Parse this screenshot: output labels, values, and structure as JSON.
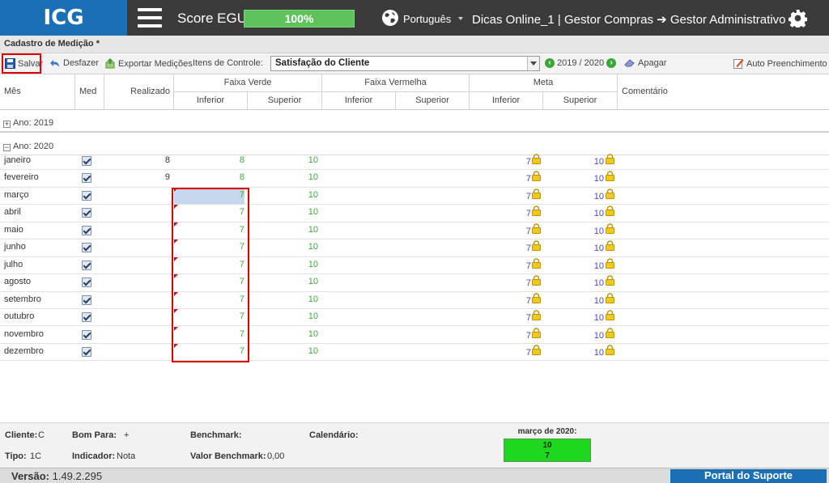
{
  "topbar": {
    "logo": "ICG",
    "score_label": "Score EGU:",
    "score_value": "100%",
    "language": "Português",
    "user_path": "Dicas Online_1  |  Gestor Compras ➔ Gestor Administrativo"
  },
  "panel": {
    "title": "Cadastro de Medição *"
  },
  "toolbar": {
    "save": "Salvar",
    "undo": "Desfazer",
    "export": "Exportar Medições",
    "items_label": "Itens de Controle:",
    "item_selected": "Satisfação do Cliente",
    "period": "2019 / 2020",
    "delete": "Apagar",
    "auto_fill": "Auto Preenchimento"
  },
  "grid": {
    "headers": {
      "mes": "Mês",
      "med": "Med",
      "realizado": "Realizado",
      "faixa_verde": "Faixa Verde",
      "faixa_vermelha": "Faixa Vermelha",
      "meta": "Meta",
      "inferior": "Inferior",
      "superior": "Superior",
      "comentario": "Comentário"
    },
    "year_2019": "Ano: 2019",
    "year_2020": "Ano: 2020",
    "rows": [
      {
        "mes": "janeiro",
        "realizado": "8",
        "verde_inf": "8",
        "verde_sup": "10",
        "meta_inf": "7",
        "meta_sup": "10"
      },
      {
        "mes": "fevereiro",
        "realizado": "9",
        "verde_inf": "8",
        "verde_sup": "10",
        "meta_inf": "7",
        "meta_sup": "10"
      },
      {
        "mes": "março",
        "realizado": "",
        "verde_inf": "7",
        "verde_sup": "10",
        "meta_inf": "7",
        "meta_sup": "10"
      },
      {
        "mes": "abril",
        "realizado": "",
        "verde_inf": "7",
        "verde_sup": "10",
        "meta_inf": "7",
        "meta_sup": "10"
      },
      {
        "mes": "maio",
        "realizado": "",
        "verde_inf": "7",
        "verde_sup": "10",
        "meta_inf": "7",
        "meta_sup": "10"
      },
      {
        "mes": "junho",
        "realizado": "",
        "verde_inf": "7",
        "verde_sup": "10",
        "meta_inf": "7",
        "meta_sup": "10"
      },
      {
        "mes": "julho",
        "realizado": "",
        "verde_inf": "7",
        "verde_sup": "10",
        "meta_inf": "7",
        "meta_sup": "10"
      },
      {
        "mes": "agosto",
        "realizado": "",
        "verde_inf": "7",
        "verde_sup": "10",
        "meta_inf": "7",
        "meta_sup": "10"
      },
      {
        "mes": "setembro",
        "realizado": "",
        "verde_inf": "7",
        "verde_sup": "10",
        "meta_inf": "7",
        "meta_sup": "10"
      },
      {
        "mes": "outubro",
        "realizado": "",
        "verde_inf": "7",
        "verde_sup": "10",
        "meta_inf": "7",
        "meta_sup": "10"
      },
      {
        "mes": "novembro",
        "realizado": "",
        "verde_inf": "7",
        "verde_sup": "10",
        "meta_inf": "7",
        "meta_sup": "10"
      },
      {
        "mes": "dezembro",
        "realizado": "",
        "verde_inf": "7",
        "verde_sup": "10",
        "meta_inf": "7",
        "meta_sup": "10"
      }
    ]
  },
  "footer": {
    "cliente_label": "Cliente:",
    "cliente_value": "C",
    "bom_para_label": "Bom Para:",
    "bom_para_value": "+",
    "benchmark_label": "Benchmark:",
    "calendario_label": "Calendário:",
    "tipo_label": "Tipo:",
    "tipo_value": "1C",
    "indicador_label": "Indicador:",
    "indicador_value": "Nota",
    "valor_benchmark_label": "Valor Benchmark:",
    "valor_benchmark_value": "0,00",
    "month_title": "março de 2020:",
    "month_line1": "10",
    "month_line2": "7"
  },
  "status": {
    "version_label": "Versão:",
    "version_value": "1.49.2.295",
    "portal": "Portal do Suporte"
  },
  "colors": {
    "brand_blue": "#1a6fb5",
    "score_green": "#5ec35a",
    "highlight_red": "#e00000",
    "value_green": "#3fa83f",
    "meta_blue": "#4a4ab5"
  }
}
